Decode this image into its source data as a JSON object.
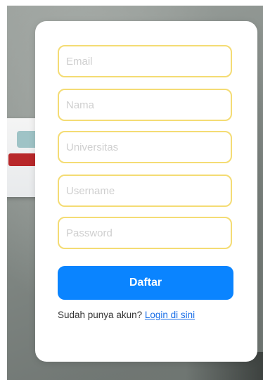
{
  "form": {
    "email_placeholder": "Email",
    "name_placeholder": "Nama",
    "university_placeholder": "Universitas",
    "username_placeholder": "Username",
    "password_placeholder": "Password",
    "submit_label": "Daftar",
    "login_prompt": "Sudah punya akun?",
    "login_link": "Login di sini"
  },
  "colors": {
    "button": "#0a84ff",
    "field_border": "#f4dc74",
    "link": "#1a6fe8"
  }
}
